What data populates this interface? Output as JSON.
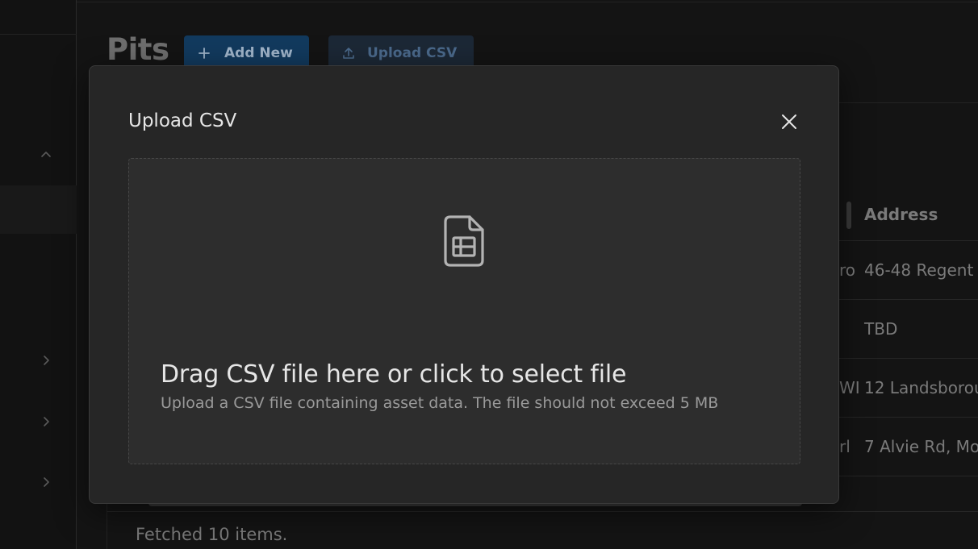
{
  "page": {
    "title": "Pits",
    "add_new_label": "Add New",
    "upload_csv_label": "Upload CSV"
  },
  "table": {
    "address_header": "Address",
    "rows": [
      {
        "partial_prev_col": "ro",
        "address": "46-48 Regent"
      },
      {
        "partial_prev_col": "",
        "address": "TBD"
      },
      {
        "partial_prev_col": "WI",
        "address": "12 Landsborou"
      },
      {
        "partial_prev_col": "rl",
        "address": "7 Alvie Rd, Mo"
      }
    ],
    "status_text": "Fetched 10 items."
  },
  "modal": {
    "title": "Upload CSV",
    "close_icon": "close-icon",
    "dropzone": {
      "icon": "csv-file-icon",
      "title": "Drag CSV file here or click to select file",
      "subtitle": "Upload a CSV file containing asset data. The file should not exceed 5 MB"
    }
  },
  "colors": {
    "background": "#141414",
    "modal_bg": "#262626",
    "dropzone_bg": "#2d2d2d",
    "primary_button": "#123a5e",
    "text_primary": "#e6e6e6",
    "text_secondary": "#9a9a9a"
  }
}
